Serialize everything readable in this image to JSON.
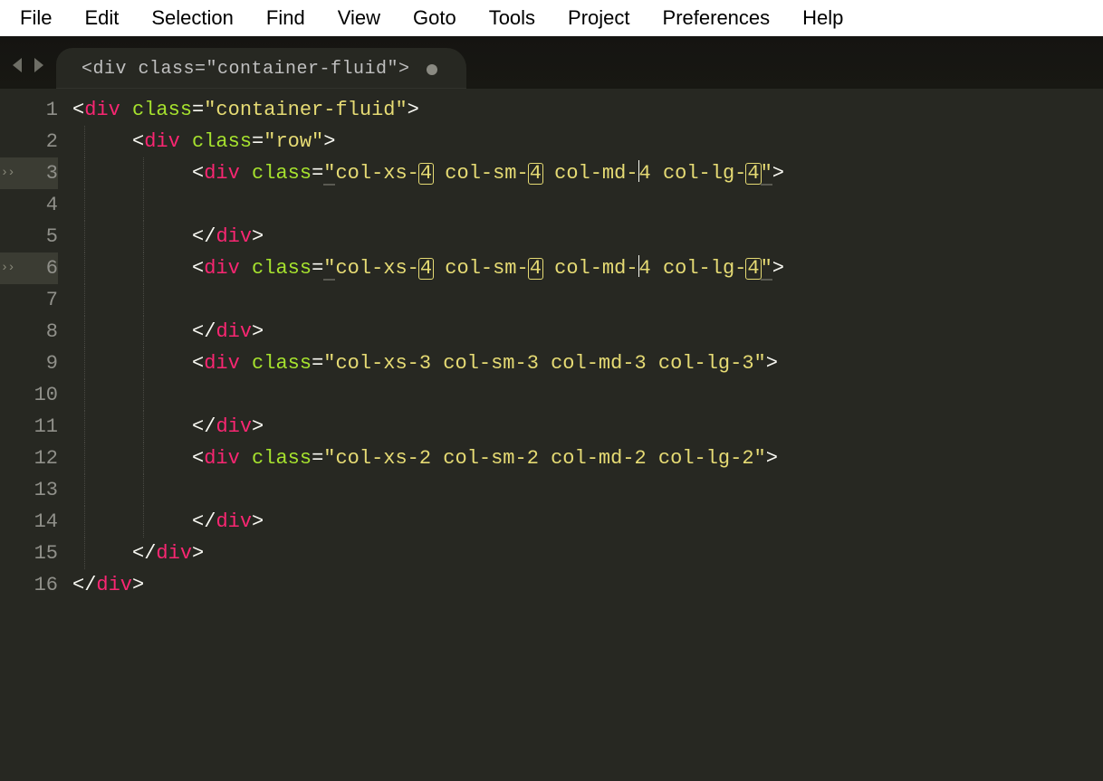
{
  "menubar": {
    "items": [
      "File",
      "Edit",
      "Selection",
      "Find",
      "View",
      "Goto",
      "Tools",
      "Project",
      "Preferences",
      "Help"
    ]
  },
  "tab": {
    "title": "<div class=\"container-fluid\">",
    "dirty": true
  },
  "gutter": {
    "lines": [
      "1",
      "2",
      "3",
      "4",
      "5",
      "6",
      "7",
      "8",
      "9",
      "10",
      "11",
      "12",
      "13",
      "14",
      "15",
      "16"
    ],
    "modified_lines": [
      3,
      6
    ]
  },
  "code": {
    "lines": [
      {
        "indent": 0,
        "type": "open",
        "tag": "div",
        "attr": "class",
        "val": "container-fluid"
      },
      {
        "indent": 1,
        "type": "open",
        "tag": "div",
        "attr": "class",
        "val": "row"
      },
      {
        "indent": 2,
        "type": "open-multi",
        "tag": "div",
        "attr": "class",
        "parts": [
          "col-xs-",
          "4",
          " col-sm-",
          "4",
          " col-md-",
          "4",
          " col-lg-",
          "4"
        ],
        "cursors": [
          1,
          3,
          5,
          7
        ],
        "underline": true
      },
      {
        "indent": 0,
        "type": "blank"
      },
      {
        "indent": 2,
        "type": "close",
        "tag": "div"
      },
      {
        "indent": 2,
        "type": "open-multi",
        "tag": "div",
        "attr": "class",
        "parts": [
          "col-xs-",
          "4",
          " col-sm-",
          "4",
          " col-md-",
          "4",
          " col-lg-",
          "4"
        ],
        "cursors": [
          1,
          3,
          5,
          7
        ],
        "underline": true
      },
      {
        "indent": 0,
        "type": "blank"
      },
      {
        "indent": 2,
        "type": "close",
        "tag": "div"
      },
      {
        "indent": 2,
        "type": "open",
        "tag": "div",
        "attr": "class",
        "val": "col-xs-3 col-sm-3 col-md-3 col-lg-3"
      },
      {
        "indent": 0,
        "type": "blank"
      },
      {
        "indent": 2,
        "type": "close",
        "tag": "div"
      },
      {
        "indent": 2,
        "type": "open",
        "tag": "div",
        "attr": "class",
        "val": "col-xs-2 col-sm-2 col-md-2 col-lg-2"
      },
      {
        "indent": 0,
        "type": "blank"
      },
      {
        "indent": 2,
        "type": "close",
        "tag": "div"
      },
      {
        "indent": 1,
        "type": "close",
        "tag": "div"
      },
      {
        "indent": 0,
        "type": "close",
        "tag": "div"
      }
    ]
  },
  "colors": {
    "bg": "#272822",
    "tag": "#f92672",
    "attr": "#a6e22e",
    "string": "#e6db74",
    "gutter": "#90908a"
  }
}
